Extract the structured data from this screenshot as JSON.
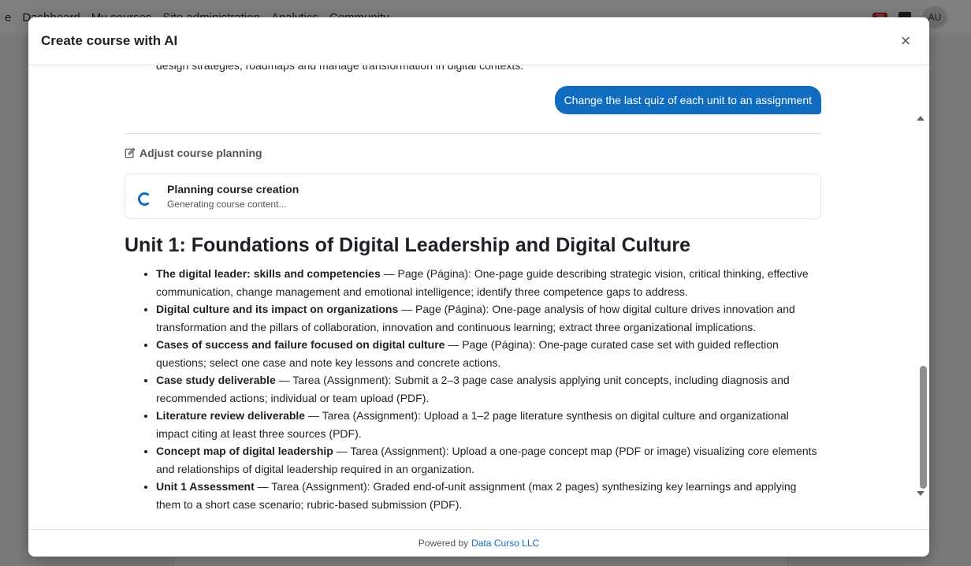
{
  "background": {
    "nav_items": [
      "e",
      "Dashboard",
      "My courses",
      "Site administration",
      "Analytics",
      "Community"
    ],
    "notification_count": "36",
    "user_initials": "AU"
  },
  "modal": {
    "title": "Create course with AI",
    "close_label": "×"
  },
  "chat": {
    "partial_text": "design strategies, roadmaps and manage transformation in digital contexts.",
    "user_message": "Change the last quiz of each unit to an assignment"
  },
  "adjust": {
    "label": "Adjust course planning"
  },
  "planning": {
    "title": "Planning course creation",
    "subtitle": "Generating course content..."
  },
  "unit": {
    "title": "Unit 1: Foundations of Digital Leadership and Digital Culture",
    "items": [
      {
        "bold": "The digital leader: skills and competencies",
        "rest": " — Page (Página): One-page guide describing strategic vision, critical thinking, effective communication, change management and emotional intelligence; identify three competence gaps to address."
      },
      {
        "bold": "Digital culture and its impact on organizations",
        "rest": " — Page (Página): One-page analysis of how digital culture drives innovation and transformation and the pillars of collaboration, innovation and continuous learning; extract three organizational implications."
      },
      {
        "bold": "Cases of success and failure focused on digital culture",
        "rest": " — Page (Página): One-page curated case set with guided reflection questions; select one case and note key lessons and concrete actions."
      },
      {
        "bold": "Case study deliverable",
        "rest": " — Tarea (Assignment): Submit a 2–3 page case analysis applying unit concepts, including diagnosis and recommended actions; individual or team upload (PDF)."
      },
      {
        "bold": "Literature review deliverable",
        "rest": " — Tarea (Assignment): Upload a 1–2 page literature synthesis on digital culture and organizational impact citing at least three sources (PDF)."
      },
      {
        "bold": "Concept map of digital leadership",
        "rest": " — Tarea (Assignment): Upload a one-page concept map (PDF or image) visualizing core elements and relationships of digital leadership required in an organization."
      },
      {
        "bold": "Unit 1 Assessment",
        "rest": " — Tarea (Assignment): Graded end-of-unit assignment (max 2 pages) synthesizing key learnings and applying them to a short case scenario; rubric-based submission (PDF)."
      }
    ]
  },
  "footer": {
    "prefix": "Powered by",
    "link_text": "Data Curso LLC"
  }
}
